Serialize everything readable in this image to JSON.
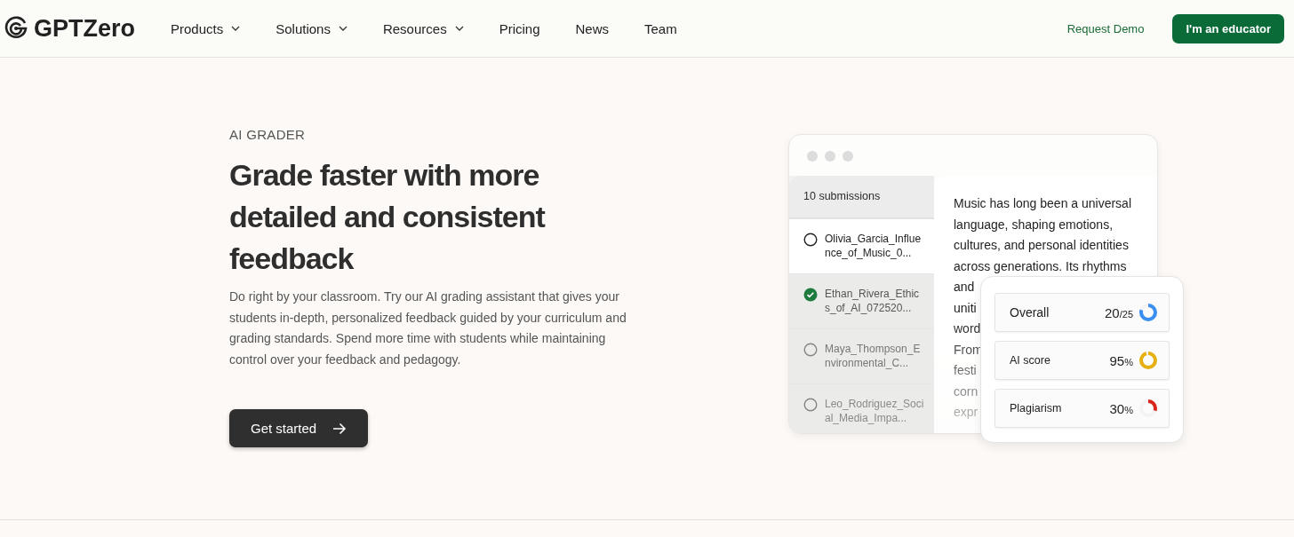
{
  "nav": {
    "logo": "GPTZero",
    "items": [
      {
        "label": "Products",
        "dropdown": true
      },
      {
        "label": "Solutions",
        "dropdown": true
      },
      {
        "label": "Resources",
        "dropdown": true
      },
      {
        "label": "Pricing",
        "dropdown": false
      },
      {
        "label": "News",
        "dropdown": false
      },
      {
        "label": "Team",
        "dropdown": false
      }
    ],
    "request_demo": "Request Demo",
    "educator_button": "I'm an educator"
  },
  "hero": {
    "eyebrow": "AI GRADER",
    "title": "Grade faster with more detailed and consistent feedback",
    "description": "Do right by your classroom. Try our AI grading assistant that gives your students in-depth, personalized feedback guided by your curriculum and grading standards. Spend more time with students while maintaining control over your feedback and pedagogy.",
    "cta": "Get started"
  },
  "mockup": {
    "submissions_header": "10 submissions",
    "submissions": [
      {
        "name": "Olivia_Garcia_Influence_of_Music_0...",
        "checked": false,
        "selected": true
      },
      {
        "name": "Ethan_Rivera_Ethics_of_AI_072520...",
        "checked": true,
        "selected": false
      },
      {
        "name": "Maya_Thompson_Environmental_C...",
        "checked": false,
        "selected": false
      },
      {
        "name": "Leo_Rodriguez_Social_Media_Impa...",
        "checked": false,
        "selected": false
      }
    ],
    "essay_lines": [
      "Music has long been a universal",
      "language, shaping emotions,",
      "cultures, and personal identities",
      "across generations. Its rhythms",
      "and",
      "uniti",
      "word",
      "From",
      "festi",
      "corn",
      "expr"
    ],
    "scores": [
      {
        "label": "Overall",
        "value": "20",
        "unit": "/25",
        "level": 0.8,
        "color": "#3b8ff0"
      },
      {
        "label": "AI score",
        "value": "95",
        "unit": "%",
        "level": 0.95,
        "color": "#e6b012"
      },
      {
        "label": "Plagiarism",
        "value": "30",
        "unit": "%",
        "level": 0.3,
        "color": "#d8261c"
      }
    ]
  }
}
